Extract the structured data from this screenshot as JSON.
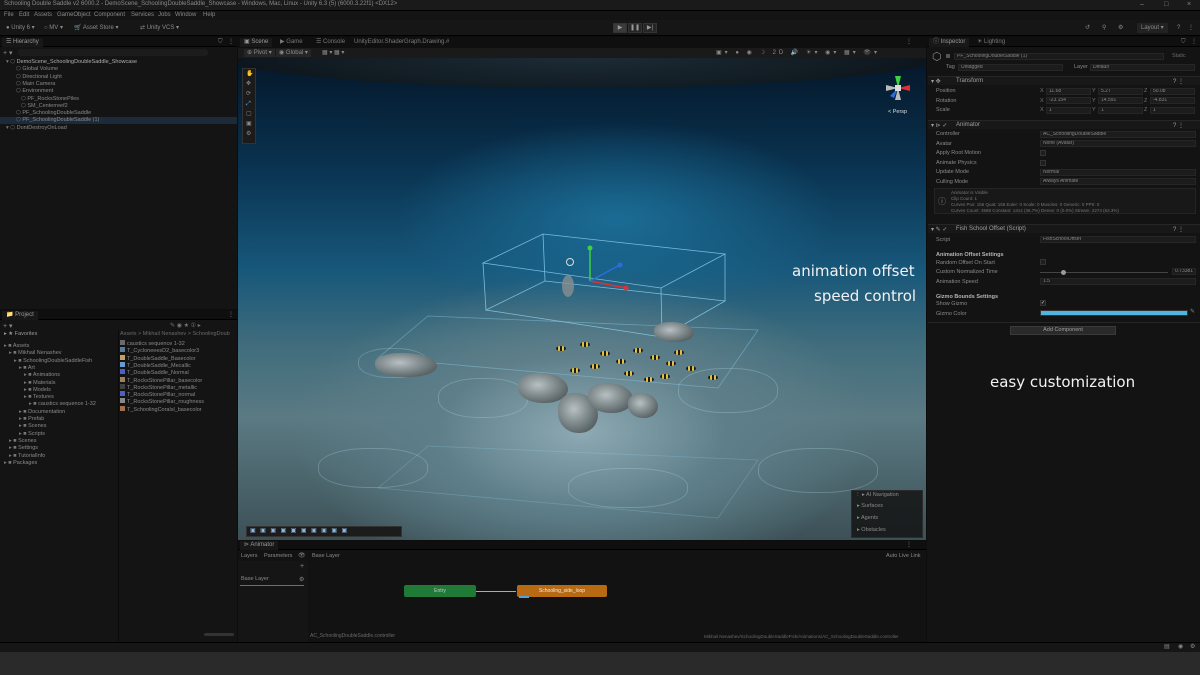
{
  "window": {
    "title": "Schooling Double Saddle v2 6000.2 - DemoScene_SchoolingDoubleSaddle_Showcase - Windows, Mac, Linux - Unity 6.3 (5) (6000.3.22f1) <DX12>"
  },
  "menu": [
    "File",
    "Edit",
    "Assets",
    "GameObject",
    "Component",
    "Services",
    "Jobs",
    "Window",
    "Help"
  ],
  "toolbar": {
    "account": "Unity 6",
    "mv": "MV",
    "store": "Asset Store",
    "vcs": "Unity VCS",
    "layout": "Layout"
  },
  "hierarchy": {
    "tab": "Hierarchy",
    "items": [
      {
        "label": "DemoScene_SchoolingDoubleSaddle_Showcase",
        "indent": 0,
        "bold": true
      },
      {
        "label": "Global Volume",
        "indent": 2
      },
      {
        "label": "Directional Light",
        "indent": 2
      },
      {
        "label": "Main Camera",
        "indent": 2
      },
      {
        "label": "Environment",
        "indent": 2
      },
      {
        "label": "PF_RocksStonePiles",
        "indent": 3
      },
      {
        "label": "SM_Centerreef2",
        "indent": 3
      },
      {
        "label": "PF_SchoolingDoubleSaddle",
        "indent": 2
      },
      {
        "label": "PF_SchoolingDoubleSaddle (1)",
        "indent": 2,
        "selected": true
      },
      {
        "label": "DontDestroyOnLoad",
        "indent": 0
      }
    ]
  },
  "project": {
    "tab": "Project",
    "favorites": "Favorites",
    "breadcrumb": "Assets > Mikhail Nenashev > SchoolingDoub",
    "tree": [
      {
        "label": "Assets",
        "indent": 0
      },
      {
        "label": "Mikhail Nenashev",
        "indent": 1
      },
      {
        "label": "SchoolingDoubleSaddleFish",
        "indent": 2
      },
      {
        "label": "Art",
        "indent": 3
      },
      {
        "label": "Animations",
        "indent": 4
      },
      {
        "label": "Materials",
        "indent": 4
      },
      {
        "label": "Models",
        "indent": 4
      },
      {
        "label": "Textures",
        "indent": 4
      },
      {
        "label": "caustics sequence 1-32",
        "indent": 5
      },
      {
        "label": "Documentation",
        "indent": 3
      },
      {
        "label": "Prefab",
        "indent": 3
      },
      {
        "label": "Scenes",
        "indent": 3
      },
      {
        "label": "Scripts",
        "indent": 3
      },
      {
        "label": "Scenes",
        "indent": 1
      },
      {
        "label": "Settings",
        "indent": 1
      },
      {
        "label": "TutorialInfo",
        "indent": 1
      },
      {
        "label": "Packages",
        "indent": 0
      }
    ],
    "files": [
      "caustics sequence 1-32",
      "T_CycloneeesD2_basecolor3",
      "T_DoubleSaddle_Basecolor",
      "T_DoubleSaddle_Mecallic",
      "T_DoubleSaddle_Normal",
      "T_RocksStonePillar_basecolor",
      "T_RocksStonePillar_metallic",
      "T_RocksStonePillar_normal",
      "T_RocksStonePillar_roughness",
      "T_SchoolingCoralsl_basecolor"
    ]
  },
  "scene": {
    "tabs": [
      "Scene",
      "Game",
      "Console",
      "UnityEditor.ShaderGraph.Drawing.#"
    ],
    "pivot": "Pivot",
    "global": "Global",
    "persp": "< Persp",
    "nav": {
      "title": "AI Navigation",
      "items": [
        "Surfaces",
        "Agents",
        "Obstacles"
      ]
    }
  },
  "inspector": {
    "tabs": [
      "Inspector",
      "Lighting"
    ],
    "object": "PF_SchoolingDoubleSaddle (1)",
    "static": "Static",
    "tag_label": "Tag",
    "tag": "Untagged",
    "layer_label": "Layer",
    "layer": "Default",
    "transform": {
      "title": "Transform",
      "rows": [
        {
          "label": "Position",
          "x": "11.68",
          "y": "5.27",
          "z": "50.08"
        },
        {
          "label": "Rotation",
          "x": "-23.154",
          "y": "14.591",
          "z": "-4.831"
        },
        {
          "label": "Scale",
          "x": "1",
          "y": "1",
          "z": "1"
        }
      ]
    },
    "animator": {
      "title": "Animator",
      "rows": [
        {
          "label": "Controller",
          "value": "AC_SchoolingDoubleSaddle"
        },
        {
          "label": "Avatar",
          "value": "None (Avatar)"
        },
        {
          "label": "Apply Root Motion",
          "value": ""
        },
        {
          "label": "Animate Physics",
          "value": ""
        },
        {
          "label": "Update Mode",
          "value": "Normal"
        },
        {
          "label": "Culling Mode",
          "value": "Always Animate"
        }
      ],
      "info": [
        "Animator is Visible",
        "Clip Count: 1",
        "Curves Pos: 156 Quat: 156 Euler: 0 Scale: 0 Muscles: 0 Generic: 0 PPtr: 0",
        "Curves Count: 3588 Constant: 1314 (36.7%) Dense: 0 (0.0%) Stream: 2274 (63.3%)"
      ]
    },
    "script": {
      "title": "Fish School Offset (Script)",
      "script_label": "Script",
      "script_value": "FishSchoolOffset",
      "settings": "Animation Offset Settings",
      "rows": [
        {
          "label": "Random Offset On Start",
          "value": ""
        },
        {
          "label": "Custom Normalized Time",
          "value": "0.73381"
        },
        {
          "label": "Animation Speed",
          "value": "1.5"
        }
      ],
      "normalized_time_fraction": 0.18,
      "gizmo_header": "Gizmo Bounds Settings",
      "show_gizmo": "Show Gizmo",
      "gizmo_color": "Gizmo Color",
      "gizmo_color_value": "#4fb6e0"
    },
    "add_component": "Add Component"
  },
  "animator_window": {
    "tab": "Animator",
    "layers": "Layers",
    "parameters": "Parameters",
    "base_layer": "Base Layer",
    "base_layer_item": "Base Layer",
    "auto_live": "Auto Live Link",
    "entry": "Entry",
    "state": "Schooling_side_loop",
    "path": "AC_SchoolingDoubleSaddle.controller"
  },
  "status": {
    "path": "Mikhail Nenashev/SchoolingDoubleSaddleFish/Animations/AC_SchoolingDoubleSaddle.controller"
  },
  "overlay": {
    "line1": "animation offset",
    "line2": "speed control",
    "line3": "easy customization"
  },
  "colors": {
    "accent": "#3a79b8",
    "entry": "#1e7a36",
    "state": "#b86a12",
    "gizmo": "#4fb6e0"
  }
}
